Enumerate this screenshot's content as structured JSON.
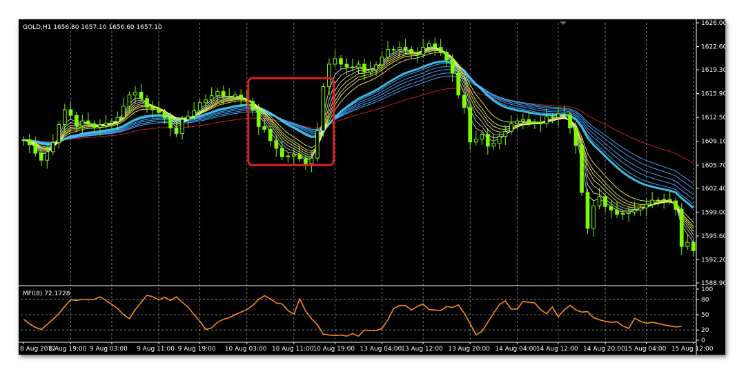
{
  "colors": {
    "background": "#000000",
    "grid": "#c8c8c8",
    "candle": "#7cfc00",
    "ma_fast": "#ffff66",
    "ma_slow": "#4aa8ff",
    "ma_lead": "#3fd0ff",
    "ma_red": "#c81e1e",
    "mfi": "#ff8c1a",
    "highlight": "#e01f1f"
  },
  "header": {
    "symbol_info": "GOLD,H1  1656.80 1657.10 1656.60 1657.10",
    "indicator_info": "MFI(8) 72.1728"
  },
  "chart_data": [
    {
      "type": "candlestick",
      "symbol": "GOLD",
      "timeframe": "H1",
      "x_ticks": [
        "8 Aug 2012",
        "8 Aug 19:00",
        "9 Aug 03:00",
        "9 Aug 11:00",
        "9 Aug 19:00",
        "10 Aug 03:00",
        "10 Aug 11:00",
        "10 Aug 19:00",
        "13 Aug 04:00",
        "13 Aug 12:00",
        "13 Aug 20:00",
        "14 Aug 04:00",
        "14 Aug 12:00",
        "14 Aug 20:00",
        "15 Aug 04:00",
        "15 Aug 12:00"
      ],
      "y_ticks": [
        "1626.00",
        "1622.60",
        "1619.30",
        "1615.90",
        "1612.50",
        "1609.10",
        "1605.70",
        "1602.40",
        "1599.00",
        "1595.60",
        "1592.20",
        "1588.90"
      ],
      "ylim": [
        1588.9,
        1626.0
      ],
      "close": [
        1609.3,
        1608.6,
        1607.4,
        1606.4,
        1607.6,
        1608.9,
        1611.5,
        1613.6,
        1612.8,
        1611.3,
        1612.0,
        1611.6,
        1611.1,
        1611.4,
        1611.7,
        1611.9,
        1612.5,
        1614.1,
        1615.7,
        1616.1,
        1615.2,
        1614.0,
        1613.6,
        1613.2,
        1612.4,
        1611.0,
        1610.2,
        1612.2,
        1612.7,
        1613.5,
        1614.6,
        1615.0,
        1615.6,
        1616.2,
        1615.5,
        1615.4,
        1615.7,
        1615.2,
        1614.8,
        1613.6,
        1611.2,
        1610.8,
        1609.2,
        1608.1,
        1606.9,
        1607.0,
        1607.2,
        1606.6,
        1605.9,
        1606.7,
        1610.6,
        1616.9,
        1620.1,
        1620.9,
        1620.1,
        1619.7,
        1619.6,
        1620.1,
        1619.0,
        1619.3,
        1620.0,
        1621.1,
        1622.2,
        1622.2,
        1622.5,
        1622.2,
        1621.7,
        1621.5,
        1622.5,
        1623.0,
        1622.5,
        1621.8,
        1620.7,
        1618.8,
        1615.7,
        1613.9,
        1609.0,
        1609.4,
        1610.1,
        1608.4,
        1608.8,
        1609.8,
        1610.5,
        1611.6,
        1612.0,
        1612.2,
        1611.7,
        1611.8,
        1611.6,
        1612.6,
        1612.5,
        1613.0,
        1612.9,
        1611.0,
        1608.5,
        1601.8,
        1596.7,
        1599.9,
        1601.2,
        1599.8,
        1599.3,
        1598.7,
        1598.8,
        1599.0,
        1599.3,
        1599.6,
        1600.1,
        1600.7,
        1600.7,
        1600.8,
        1600.6,
        1599.4,
        1594.1,
        1594.7,
        1593.5
      ],
      "mfi": {
        "name": "MFI(8)",
        "value": "72.1728",
        "levels": [
          80,
          50,
          20
        ],
        "y_ticks": [
          "100",
          "80",
          "50",
          "20",
          "0"
        ],
        "values": [
          41,
          32,
          25,
          21,
          31,
          41,
          52,
          66,
          79,
          78,
          80,
          79,
          80,
          85,
          78,
          70,
          62,
          50,
          42,
          60,
          74,
          88,
          85,
          79,
          84,
          78,
          85,
          74,
          65,
          50,
          37,
          21,
          24,
          35,
          41,
          44,
          50,
          55,
          60,
          68,
          80,
          87,
          81,
          73,
          71,
          58,
          51,
          81,
          57,
          42,
          30,
          12,
          10,
          9,
          10,
          8,
          13,
          8,
          20,
          19,
          19,
          23,
          40,
          62,
          68,
          68,
          59,
          66,
          71,
          60,
          59,
          58,
          66,
          64,
          69,
          53,
          32,
          11,
          17,
          35,
          53,
          70,
          77,
          61,
          61,
          76,
          74,
          73,
          60,
          52,
          65,
          46,
          59,
          68,
          59,
          55,
          56,
          44,
          40,
          37,
          35,
          36,
          28,
          23,
          43,
          37,
          33,
          35,
          33,
          30,
          28,
          26,
          27
        ]
      },
      "annotation": {
        "type": "rounded-rectangle",
        "from_label": "10 Aug 03:00",
        "to_label": "10 Aug 19:00",
        "y_range": [
          1605.7,
          1618.1
        ]
      }
    }
  ]
}
